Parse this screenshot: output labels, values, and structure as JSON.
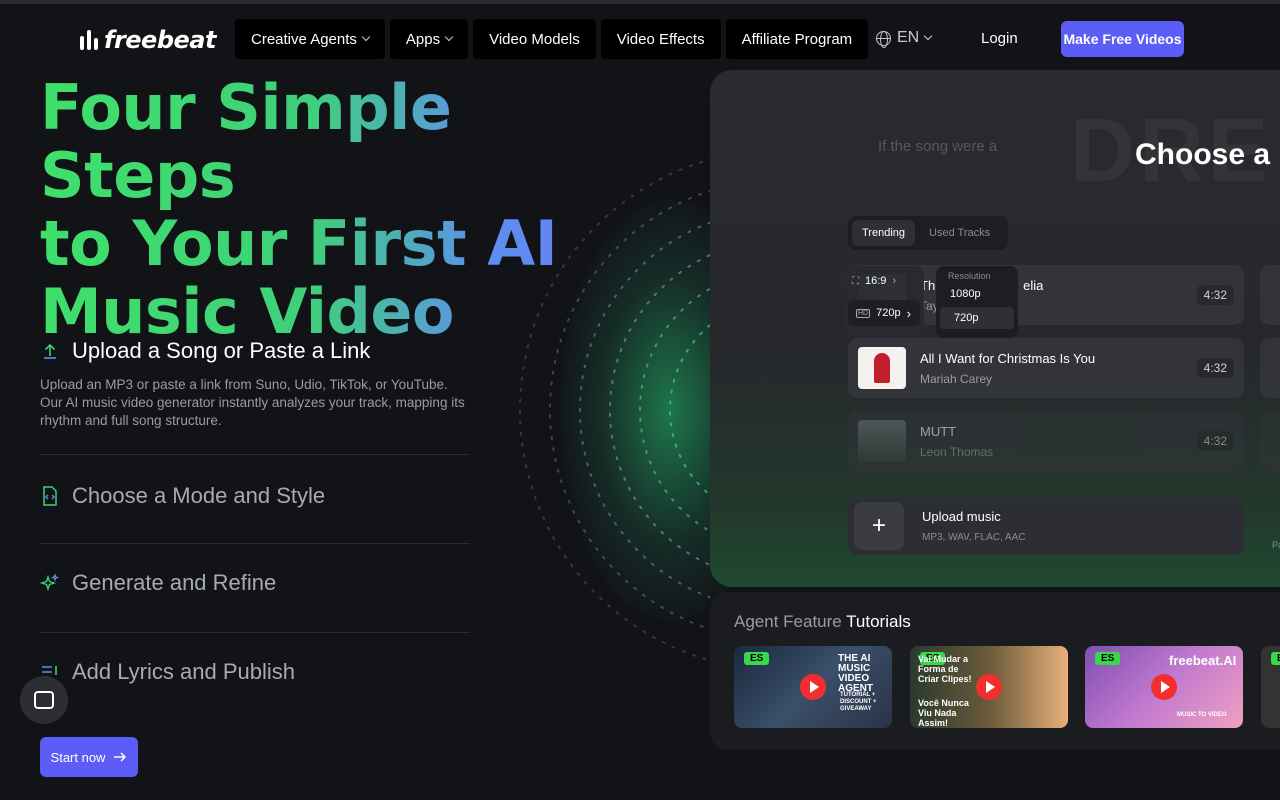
{
  "header": {
    "logo_text": "freebeat",
    "nav": [
      {
        "label": "Creative Agents",
        "has_dropdown": true
      },
      {
        "label": "Apps",
        "has_dropdown": true
      },
      {
        "label": "Video Models",
        "has_dropdown": false
      },
      {
        "label": "Video Effects",
        "has_dropdown": false
      },
      {
        "label": "Affiliate Program",
        "has_dropdown": false
      }
    ],
    "language": "EN",
    "login_label": "Login",
    "cta_label": "Make Free Videos"
  },
  "hero": {
    "title_lines": [
      "Four Simple Steps",
      "to Your First AI",
      "Music Video"
    ]
  },
  "steps": [
    {
      "title": "Upload a Song or Paste a Link",
      "description": "Upload an MP3 or paste a link from Suno, Udio, TikTok, or YouTube. Our AI music video generator instantly analyzes your track, mapping its rhythm and full song structure.",
      "active": true,
      "icon": "upload-icon"
    },
    {
      "title": "Choose a Mode and Style",
      "active": false,
      "icon": "file-code-icon"
    },
    {
      "title": "Generate and Refine",
      "active": false,
      "icon": "sparkle-icon"
    },
    {
      "title": "Add Lyrics and Publish",
      "active": false,
      "icon": "lyrics-icon"
    }
  ],
  "start_label": "Start now",
  "panel": {
    "hint": "If the song were a",
    "title": "Choose a",
    "tabs": [
      "Trending",
      "Used Tracks"
    ],
    "active_tab": "Trending",
    "tracks": [
      {
        "name": "The Fate of Ophelia",
        "name_visible": "Th",
        "name_tail": "elia",
        "artist": "Tay",
        "duration": "4:32"
      },
      {
        "name": "All I Want for Christmas Is You",
        "artist": "Mariah Carey",
        "duration": "4:32"
      },
      {
        "name": "MUTT",
        "artist": "Leon Thomas",
        "duration": "4:32"
      }
    ],
    "aspect_label": "16:9",
    "aspect_res": "720p",
    "resolution_label": "Resolution",
    "resolution_options": [
      "1080p",
      "720p"
    ],
    "upload_title": "Upload music",
    "upload_formats": "MP3, WAV, FLAC, AAC",
    "side_label": "Pa"
  },
  "tutorials": {
    "title_prefix": "Agent Feature",
    "title_strong": "Tutorials",
    "cards": [
      {
        "badge": "ES",
        "text": "THE AI MUSIC VIDEO AGENT",
        "sub": "TUTORIAL + DISCOUNT + GIVEAWAY"
      },
      {
        "badge": "ES",
        "text": "Vai Mudar a Forma de Criar Clipes!",
        "sub": "Você Nunca Viu Nada Assim!"
      },
      {
        "badge": "ES",
        "text": "freebeat.AI",
        "sub": "MUSIC TO VIDEO"
      },
      {
        "badge": "ES",
        "text": "",
        "sub": ""
      }
    ]
  },
  "colors": {
    "accent": "#5c5cf6",
    "gradient_start": "#3fe06a",
    "gradient_end": "#6a7cf5",
    "background": "#121316"
  }
}
